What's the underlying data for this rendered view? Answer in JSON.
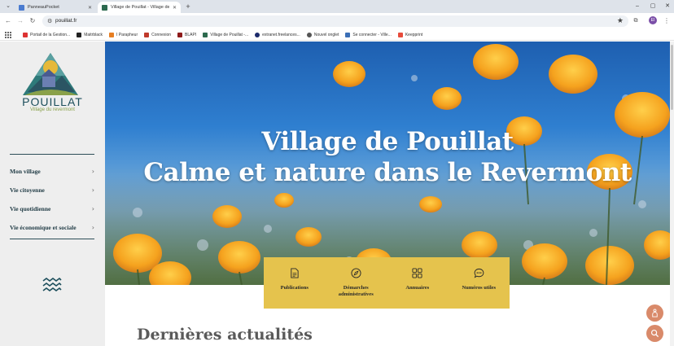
{
  "browser": {
    "tabs": [
      {
        "title": "PanneauPocket",
        "active": false,
        "favicon_color": "#4a7bd0"
      },
      {
        "title": "Village de Pouillat - Village de l",
        "active": true,
        "favicon_color": "#2d6a4f"
      }
    ],
    "new_tab_symbol": "+",
    "url": "pouillat.fr",
    "profile_initial": "EI",
    "bookmarks": [
      {
        "label": "Portail de la Gestion...",
        "color": "#d33"
      },
      {
        "label": "Maitrblack",
        "color": "#222"
      },
      {
        "label": "I Parapheur",
        "color": "#e67e22"
      },
      {
        "label": "Connexion",
        "color": "#c0392b"
      },
      {
        "label": "BLAPI",
        "color": "#8e1b1b"
      },
      {
        "label": "Village de Pouillat -...",
        "color": "#2d6a4f"
      },
      {
        "label": "extranet.freelances...",
        "color": "#1b2a6b"
      },
      {
        "label": "Nouvel onglet",
        "color": "#555"
      },
      {
        "label": "Se connecter - Ville...",
        "color": "#3b6fb6"
      },
      {
        "label": "Keepprint",
        "color": "#e74c3c"
      }
    ]
  },
  "site": {
    "brand": "POUILLAT",
    "tagline": "Village du revermont",
    "menu": [
      {
        "label": "Mon village"
      },
      {
        "label": "Vie citoyenne"
      },
      {
        "label": "Vie quotidienne"
      },
      {
        "label": "Vie économique et sociale"
      }
    ],
    "hero": {
      "line1": "Village de Pouillat",
      "line2": "Calme et nature dans le Revermont"
    },
    "quicklinks": [
      {
        "label": "Publications",
        "icon": "document-icon"
      },
      {
        "label": "Démarches administratives",
        "icon": "compass-icon"
      },
      {
        "label": "Annuaires",
        "icon": "grid-icon"
      },
      {
        "label": "Numéros utiles",
        "icon": "chat-icon"
      }
    ],
    "news_title": "Dernières actualités",
    "colors": {
      "accent_yellow": "#e5c34d",
      "dark_teal": "#1d4f5c",
      "fab": "#d98a6a"
    }
  }
}
